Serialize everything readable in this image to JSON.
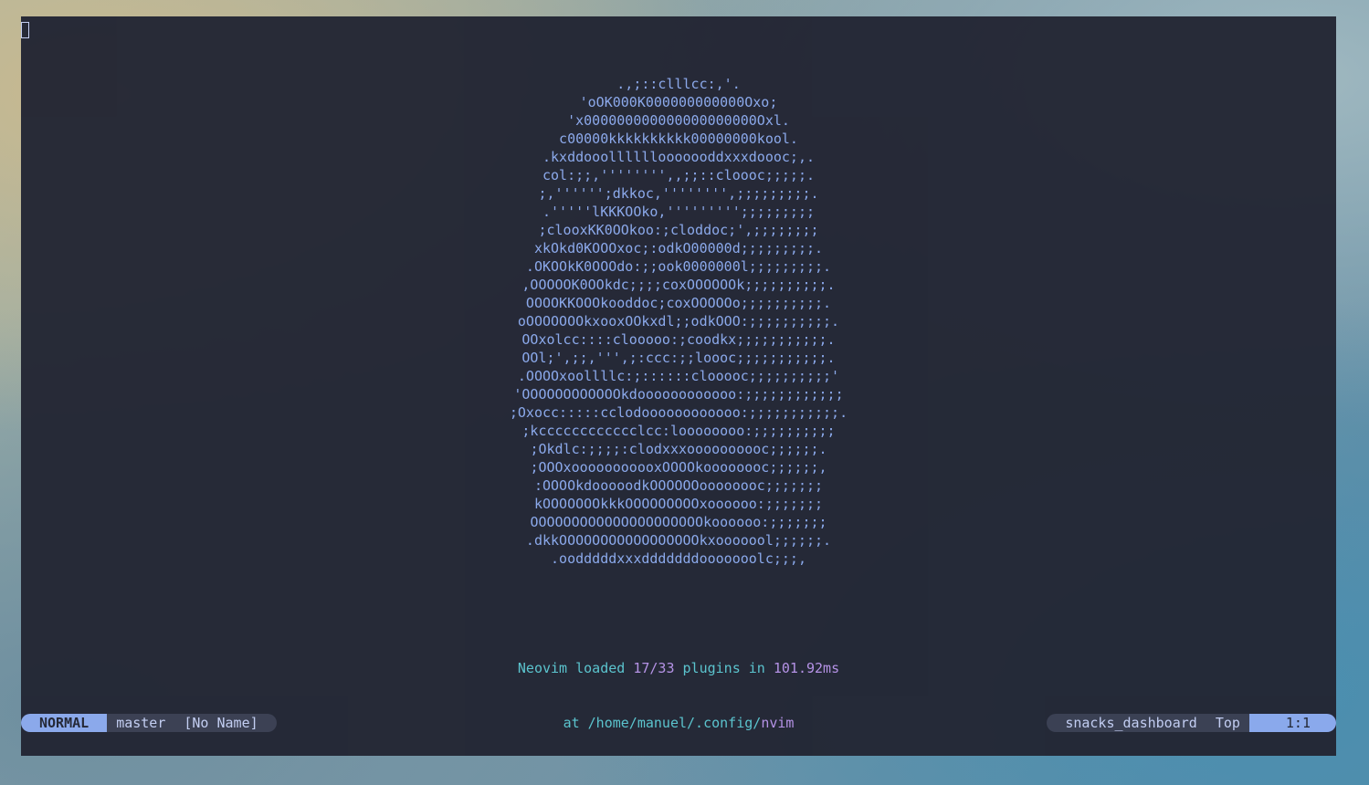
{
  "ascii_art": [
    ".,;::clllcc:,'.",
    "'oOK000K000000000000Oxo;",
    "'x000000000000000000000Oxl.",
    "c00000kkkkkkkkkk00000000kool.",
    ".kxddooollllllooooooddxxxdoooc;,.",
    "col:;;,'''''''',,;;::cloooc;;;;;.",
    ";,'''''';dkkoc,'''''''',;;;;;;;;;.",
    ".'''''lKKKOOko,''''''''';;;;;;;;;",
    ";clooxKK0OOkoo:;cloddoc;',;;;;;;;;",
    "xkOkd0KOOOxoc;:odkO00000d;;;;;;;;;.",
    ".OKOOkK0OOOdo:;;ook0000000l;;;;;;;;;.",
    ",OOOOOK0OOkdc;;;;coxOOOOOOk;;;;;;;;;;.",
    "OOOOKKOOOkooddoc;coxOOOOOo;;;;;;;;;;.",
    "oOOOOOOOkxooxOOkxdl;;odkOOO:;;;;;;;;;;.",
    "OOxolcc::::clooooo:;coodkx;;;;;;;;;;;.",
    "OOl;',;;,''',;:ccc:;;loooc;;;;;;;;;;;.",
    ".OOOOxoollllc:;::::::clooooc;;;;;;;;;;'",
    "'OOOOOOOOOOOOkdoooooooooooo:;;;;;;;;;;;;",
    ";Oxocc:::::cclodoooooooooooo:;;;;;;;;;;;.",
    ";kcccccccccccclcc:loooooooo:;;;;;;;;;;",
    ";Okdlc:;;;;:clodxxxoooooooooc;;;;;;.",
    ";OOOxooooooooooxOOOOkoooooooc;;;;;;,",
    ":OOOOkdooooodkOOOOOOoooooooc;;;;;;;",
    "kOOOOOOOkkkOOOOOOOOOxoooooo:;;;;;;;",
    "OOOOOOOOOOOOOOOOOOOOOkoooooo:;;;;;;;",
    ".dkkOOOOOOOOOOOOOOOOOkxooooool;;;;;;.",
    ".oodddddxxxdddddddooooooolc;;;,"
  ],
  "footer": {
    "loaded_prefix": "Neovim loaded ",
    "plugin_count": "17/33",
    "plugins_word": " plugins in ",
    "load_time": "101.92ms",
    "at_prefix": "at ",
    "config_path": "/home/manuel/.config/",
    "config_dir": "nvim"
  },
  "statusline": {
    "mode": "NORMAL",
    "branch": "master",
    "buffer_name": "[No Name]",
    "filetype": "snacks_dashboard",
    "scroll": "Top",
    "cursor_pos": "1:1"
  },
  "colors": {
    "background": "#232634",
    "art": "#8caaee",
    "accent_cyan": "#5bc6d0",
    "accent_mauve": "#b893e8",
    "mode_bg": "#8caaee"
  }
}
